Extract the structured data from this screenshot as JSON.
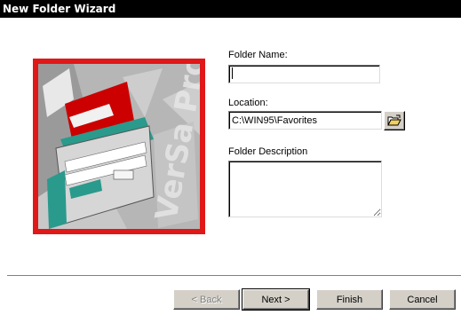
{
  "window": {
    "title": "New Folder Wizard"
  },
  "graphic": {
    "watermark_text": "VerSa Pro"
  },
  "form": {
    "folder_name_label": "Folder Name:",
    "folder_name_value": "",
    "location_label": "Location:",
    "location_value": "C:\\WIN95\\Favorites",
    "description_label": "Folder Description",
    "description_value": ""
  },
  "buttons": {
    "back": "< Back",
    "next": "Next >",
    "finish": "Finish",
    "cancel": "Cancel"
  },
  "colors": {
    "titlebar": "#000000",
    "frame_red": "#e01818",
    "folder_red": "#cc0000",
    "folder_teal": "#2a9a8c"
  },
  "icons": {
    "browse": "open-folder-icon"
  }
}
